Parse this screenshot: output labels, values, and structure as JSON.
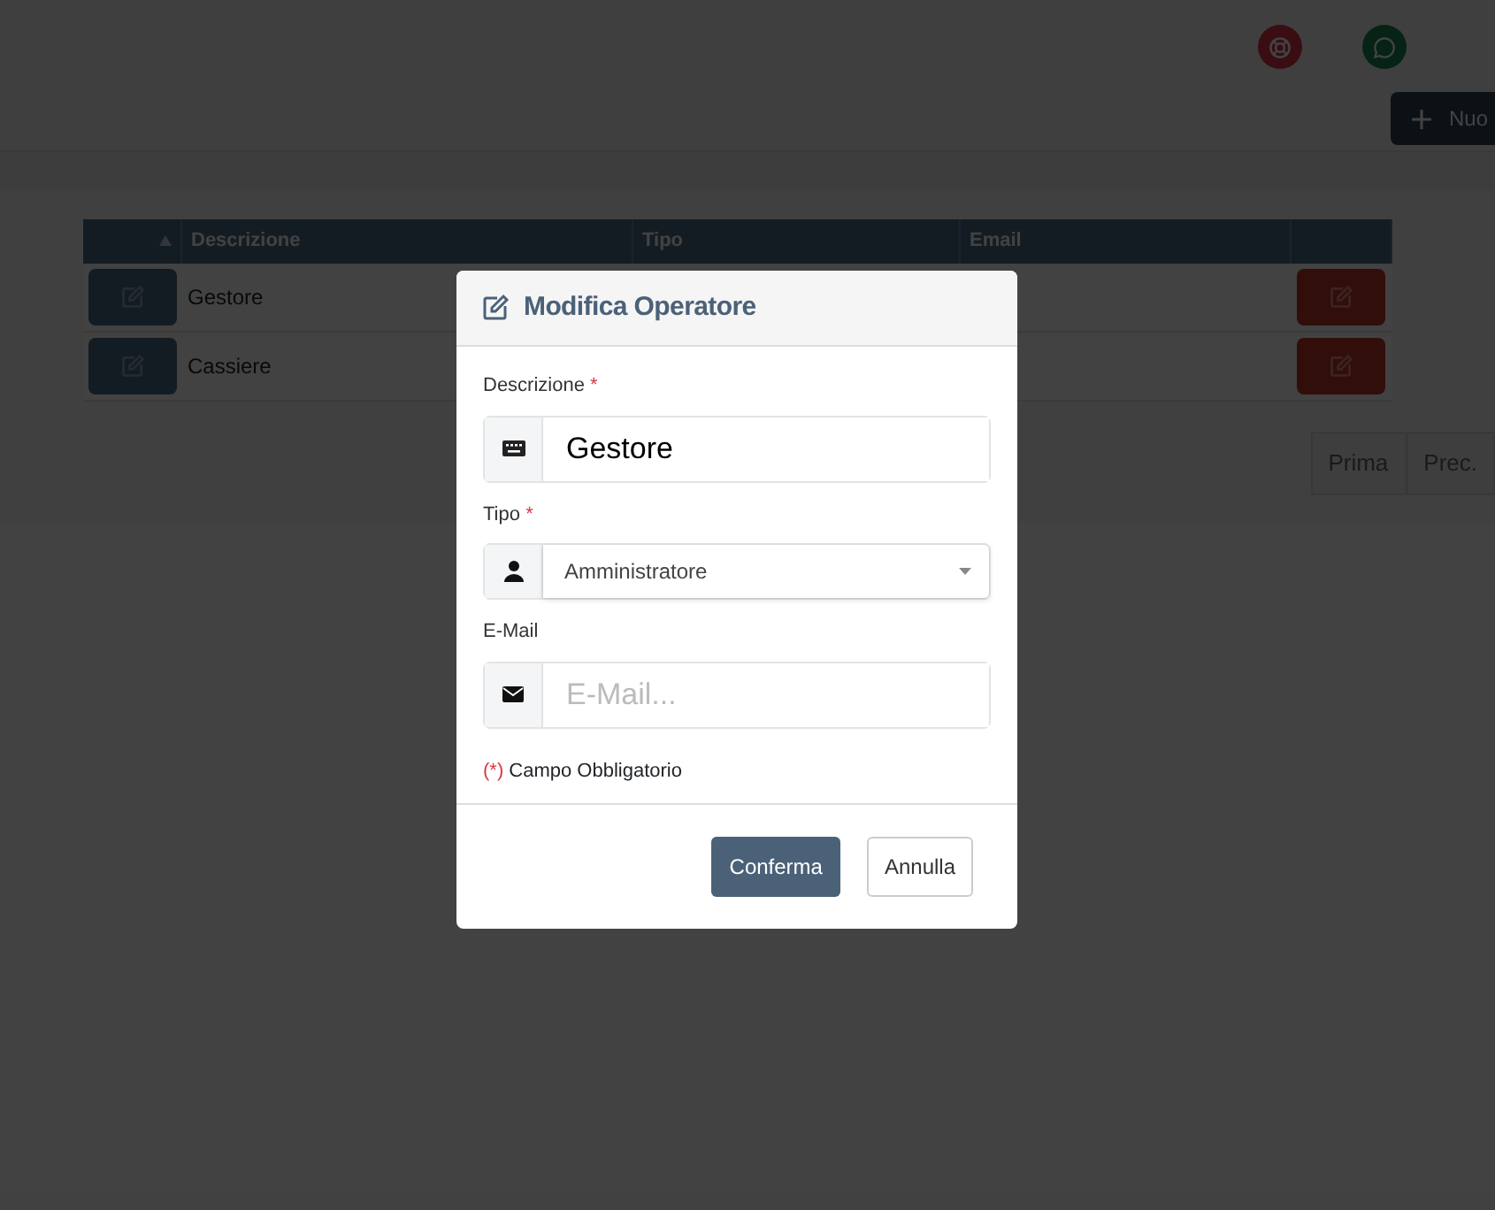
{
  "header": {
    "icons": [
      {
        "kind": "lifebuoy"
      },
      {
        "kind": "chat"
      }
    ],
    "new_button": {
      "label": "Nuo"
    }
  },
  "table": {
    "columns": [
      {
        "sorted": true
      },
      {
        "label": "Descrizione",
        "sorted": false
      },
      {
        "label": "Tipo",
        "sorted": false
      },
      {
        "label": "Email",
        "sorted": false
      },
      {
        "sorted": false
      }
    ],
    "rows": [
      {
        "descrizione": "Gestore"
      },
      {
        "descrizione": "Cassiere"
      }
    ]
  },
  "pagination": [
    "Prima",
    "Prec."
  ],
  "modal": {
    "title": "Modifica Operatore",
    "fields": [
      {
        "kind": "text",
        "label": "Descrizione",
        "required_mark": "*",
        "value": "Gestore"
      },
      {
        "kind": "select",
        "label": "Tipo",
        "required_mark": "*",
        "value": "Amministratore"
      },
      {
        "kind": "email",
        "label": "E-Mail",
        "placeholder": "E-Mail..."
      }
    ],
    "required_mark": "(*)",
    "note": "Campo Obbligatorio",
    "buttons": [
      {
        "kind": "primary",
        "label": "Conferma"
      },
      {
        "kind": "secondary",
        "label": "Annulla"
      }
    ]
  }
}
